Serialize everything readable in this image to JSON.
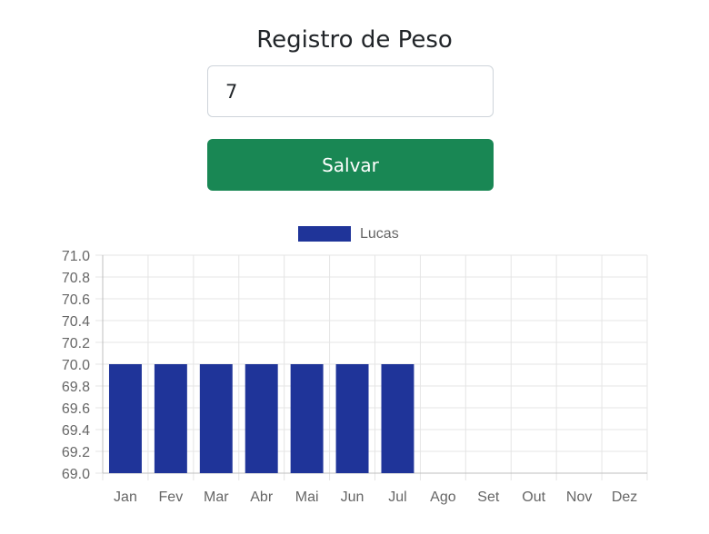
{
  "header": {
    "title": "Registro de Peso"
  },
  "form": {
    "weight_value": "7",
    "save_label": "Salvar"
  },
  "colors": {
    "primary_button": "#198754",
    "bar_fill": "#1f3499",
    "grid": "#e5e5e5",
    "tick_text": "#666666"
  },
  "chart_data": {
    "type": "bar",
    "categories": [
      "Jan",
      "Fev",
      "Mar",
      "Abr",
      "Mai",
      "Jun",
      "Jul",
      "Ago",
      "Set",
      "Out",
      "Nov",
      "Dez"
    ],
    "series": [
      {
        "name": "Lucas",
        "color": "#1f3499",
        "values": [
          70.0,
          70.0,
          70.0,
          70.0,
          70.0,
          70.0,
          70.0,
          null,
          null,
          null,
          null,
          null
        ]
      }
    ],
    "y_ticks": [
      "71.0",
      "70.8",
      "70.6",
      "70.4",
      "70.2",
      "70.0",
      "69.8",
      "69.6",
      "69.4",
      "69.2",
      "69.0"
    ],
    "ylim": [
      69.0,
      71.0
    ],
    "grid": true,
    "legend": "top-center"
  }
}
